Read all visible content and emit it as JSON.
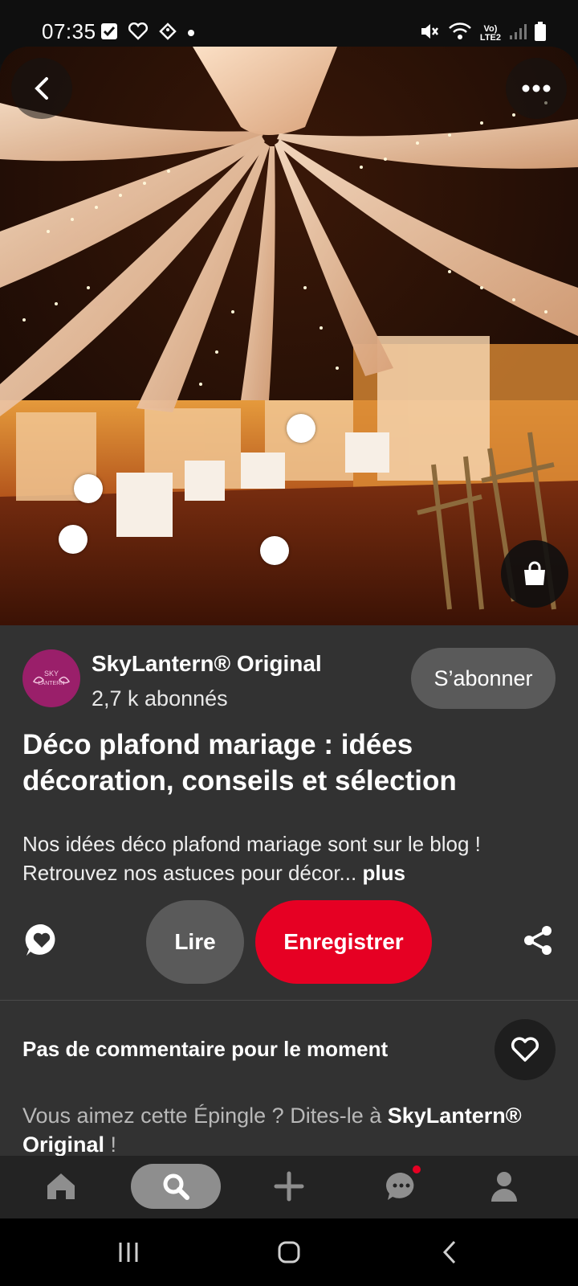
{
  "status_bar": {
    "time": "07:35",
    "lte_label_top": "Vo)",
    "lte_label_bottom": "LTE2",
    "icons": [
      "checkbox-icon",
      "heart-outline-icon",
      "tag-icon",
      "dot-icon",
      "mute-icon",
      "wifi-icon",
      "signal-icon",
      "battery-icon"
    ]
  },
  "hero": {
    "description_icons": [
      "back-arrow-icon",
      "more-dots-icon",
      "shopping-bag-icon"
    ],
    "hotspot_count": 4
  },
  "creator": {
    "name": "SkyLantern® Original",
    "followers": "2,7 k abonnés",
    "avatar_text_top": "SKY",
    "avatar_text_bottom": "LANTERN",
    "subscribe_label": "S’abonner",
    "avatar_color": "#9a1f6a"
  },
  "pin": {
    "title": "Déco plafond mariage : idées décoration, conseils et sélection",
    "description": "Nos idées déco plafond mariage sont sur le blog ! Retrouvez nos astuces pour décor...",
    "more_label": "plus"
  },
  "actions": {
    "read_label": "Lire",
    "save_label": "Enregistrer",
    "save_color": "#e60023"
  },
  "comments": {
    "title": "Pas de commentaire pour le moment",
    "cta_prefix": "Vous aimez cette Épingle ? Dites-le à ",
    "cta_name": "SkyLantern® Original",
    "cta_suffix": " !"
  },
  "bottom_nav": {
    "items": [
      "home-icon",
      "search-icon",
      "plus-icon",
      "chat-icon",
      "profile-icon"
    ],
    "active": "search-icon"
  }
}
